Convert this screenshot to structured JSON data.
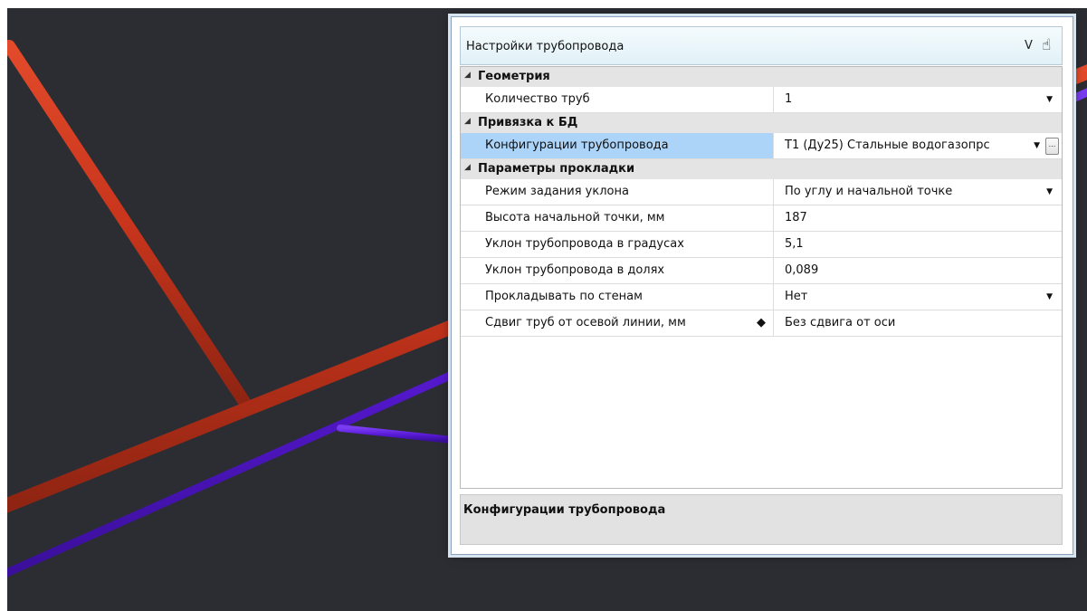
{
  "colors": {
    "viewport_bg": "#2b2d33",
    "pipe_red": "#c8351c",
    "pipe_blue": "#5a1ad8",
    "selection": "#acd3f8",
    "category_bg": "#e4e4e4"
  },
  "panel": {
    "title": "Настройки трубопровода",
    "title_button_v": "V",
    "title_icon": "hand-pointer-icon",
    "categories": [
      {
        "label": "Геометрия",
        "rows": [
          {
            "name": "Количество труб",
            "value": "1",
            "dropdown": true
          }
        ]
      },
      {
        "label": "Привязка к БД",
        "rows": [
          {
            "name": "Конфигурации трубопровода",
            "value": "Т1 (Ду25) Стальные водогазопрс",
            "dropdown": true,
            "ellipsis": "...",
            "selected": true
          }
        ]
      },
      {
        "label": "Параметры прокладки",
        "rows": [
          {
            "name": "Режим задания уклона",
            "value": "По углу и начальной точке",
            "dropdown": true
          },
          {
            "name": "Высота начальной точки, мм",
            "value": "187"
          },
          {
            "name": "Уклон трубопровода в градусах",
            "value": "5,1"
          },
          {
            "name": "Уклон трубопровода в долях",
            "value": "0,089"
          },
          {
            "name": "Прокладывать по стенам",
            "value": "Нет",
            "dropdown": true
          },
          {
            "name": "Сдвиг труб от осевой линии, мм",
            "value": "Без сдвига от оси",
            "diamond": "◆"
          }
        ]
      }
    ],
    "description_title": "Конфигурации трубопровода"
  }
}
